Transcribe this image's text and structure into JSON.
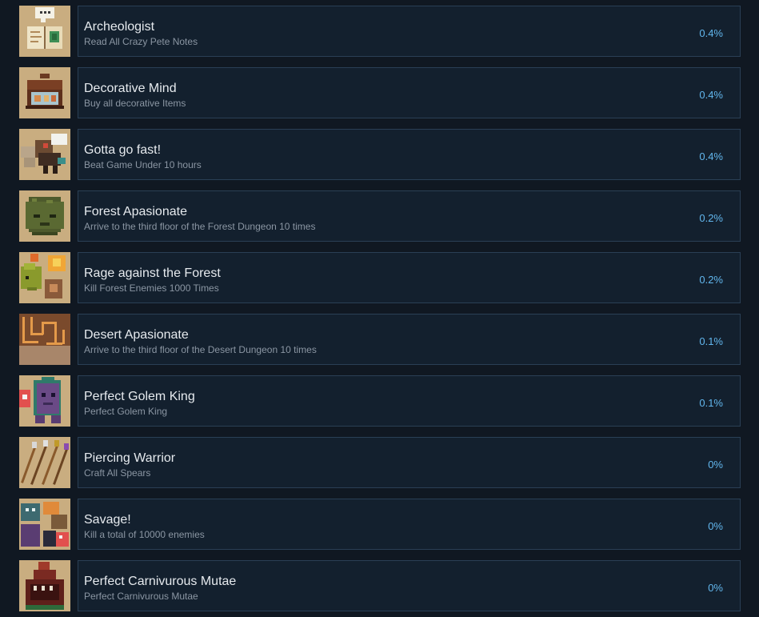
{
  "achievements": [
    {
      "name": "Archeologist",
      "description": "Read All Crazy Pete Notes",
      "percent": "0.4%",
      "icon": "book-notes-icon"
    },
    {
      "name": "Decorative Mind",
      "description": "Buy all decorative Items",
      "percent": "0.4%",
      "icon": "treasure-chest-icon"
    },
    {
      "name": "Gotta go fast!",
      "description": "Beat Game Under 10 hours",
      "percent": "0.4%",
      "icon": "running-character-icon"
    },
    {
      "name": "Forest Apasionate",
      "description": "Arrive to the third floor of the Forest Dungeon 10 times",
      "percent": "0.2%",
      "icon": "forest-golem-head-icon"
    },
    {
      "name": "Rage against the Forest",
      "description": "Kill Forest Enemies 1000 Times",
      "percent": "0.2%",
      "icon": "forest-creatures-icon"
    },
    {
      "name": "Desert Apasionate",
      "description": "Arrive to the third floor of the Desert Dungeon 10 times",
      "percent": "0.1%",
      "icon": "desert-maze-icon"
    },
    {
      "name": "Perfect Golem King",
      "description": "Perfect Golem King",
      "percent": "0.1%",
      "icon": "golem-king-icon"
    },
    {
      "name": "Piercing Warrior",
      "description": "Craft All Spears",
      "percent": "0%",
      "icon": "spears-icon"
    },
    {
      "name": "Savage!",
      "description": "Kill a total of 10000 enemies",
      "percent": "0%",
      "icon": "monster-group-icon"
    },
    {
      "name": "Perfect Carnivurous Mutae",
      "description": "Perfect Carnivurous Mutae",
      "percent": "0%",
      "icon": "carnivorous-mutae-icon"
    }
  ],
  "colors": {
    "page_background": "#101822",
    "panel_background": "#13202e",
    "panel_border": "#2a3f55",
    "title_text": "#e6eaee",
    "description_text": "#8b96a3",
    "percent_text": "#62b7ee",
    "icon_background": "#cdb48a"
  }
}
